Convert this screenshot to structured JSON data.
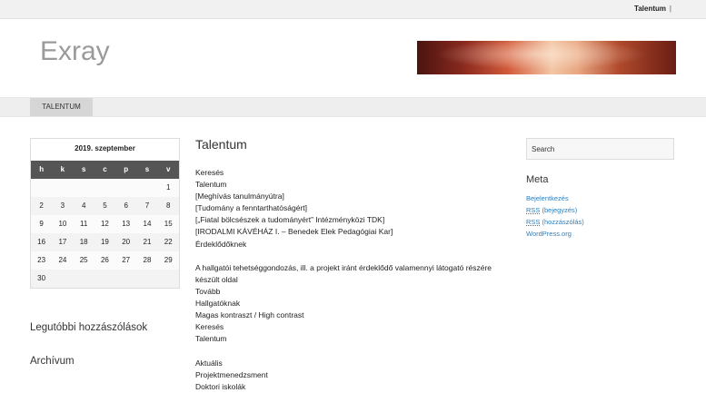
{
  "topbar": {
    "link": "Talentum",
    "separator": "|"
  },
  "site": {
    "title": "Exray"
  },
  "nav": {
    "tabs": [
      {
        "label": "TALENTUM"
      }
    ]
  },
  "calendar": {
    "caption": "2019. szeptember",
    "weekdays": [
      "h",
      "k",
      "s",
      "c",
      "p",
      "s",
      "v"
    ],
    "weeks": [
      [
        "",
        "",
        "",
        "",
        "",
        "",
        "1"
      ],
      [
        "2",
        "3",
        "4",
        "5",
        "6",
        "7",
        "8"
      ],
      [
        "9",
        "10",
        "11",
        "12",
        "13",
        "14",
        "15"
      ],
      [
        "16",
        "17",
        "18",
        "19",
        "20",
        "21",
        "22"
      ],
      [
        "23",
        "24",
        "25",
        "26",
        "27",
        "28",
        "29"
      ],
      [
        "30",
        "",
        "",
        "",
        "",
        "",
        ""
      ]
    ]
  },
  "left_widgets": {
    "recent_comments": "Legutóbbi hozzászólások",
    "archive": "Archívum"
  },
  "post": {
    "title": "Talentum",
    "lines": [
      "Keresés",
      "Talentum",
      "[Meghívás tanulmányútra]",
      "[Tudomány a fenntarthatóságért]",
      "[„Fiatal bölcsészek a tudományért” Intézményközi TDK]",
      "[IRODALMI KÁVÉHÁZ I. – Benedek Elek Pedagógiai Kar]",
      "Érdeklődőknek",
      "",
      "A hallgatói tehetséggondozás, ill. a projekt iránt érdeklődő valamennyi látogató részére",
      "készült oldal",
      "Tovább",
      "Hallgatóknak",
      "Magas kontraszt / High contrast",
      "Keresés",
      "Talentum",
      "",
      "Aktuális",
      "Projektmenedzsment",
      "Doktori iskolák"
    ]
  },
  "sidebar": {
    "search_placeholder": "Search",
    "meta_title": "Meta",
    "meta_links": {
      "login": "Bejelentkezés",
      "rss_abbr_1": "RSS",
      "rss_1": " (bejegyzés)",
      "rss_abbr_2": "RSS",
      "rss_2": " (hozzászólás)",
      "wordpress": "WordPress.org"
    }
  }
}
